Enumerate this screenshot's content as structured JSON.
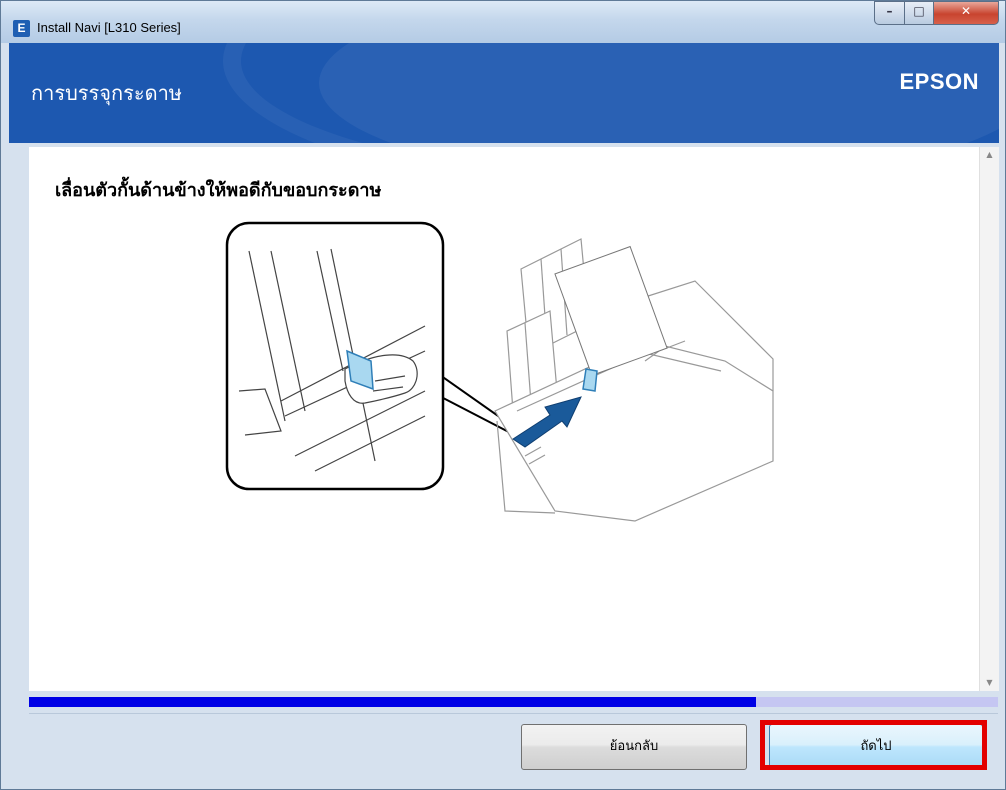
{
  "window": {
    "title": "Install Navi [L310 Series]",
    "icon": "epson-e-icon",
    "controls": {
      "minimize": "minimize-icon",
      "maximize": "maximize-icon",
      "close": "close-icon"
    }
  },
  "header": {
    "title": "การบรรจุกระดาษ",
    "brand": "EPSON",
    "color": "#1d58b0"
  },
  "content": {
    "instruction": "เลื่อนตัวกั้นด้านข้างให้พอดีกับขอบกระดาษ",
    "illustration": "edge-guide-slide-illustration"
  },
  "progress": {
    "fraction": 0.75,
    "fill_color": "#0000e6",
    "track_color": "#c5c6f2"
  },
  "footer": {
    "back_label": "ย้อนกลับ",
    "next_label": "ถัดไป",
    "next_highlight_color": "#e30000"
  }
}
